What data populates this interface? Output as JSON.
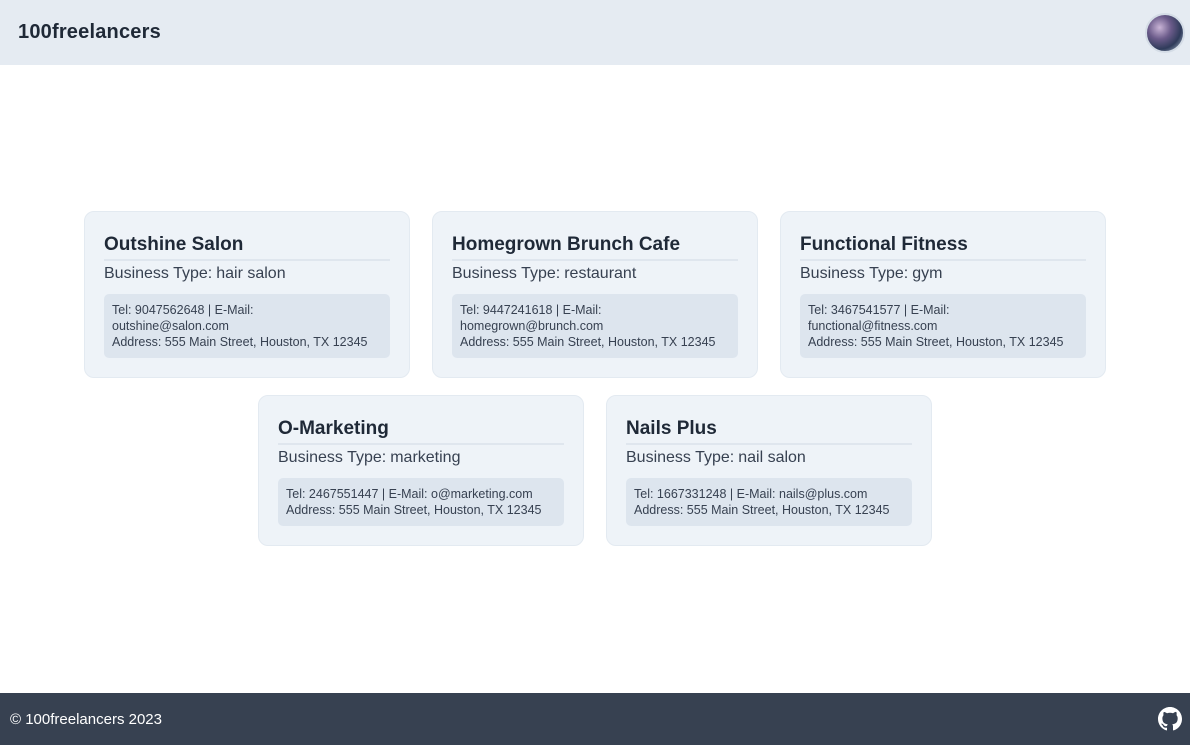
{
  "header": {
    "brand": "100freelancers"
  },
  "business_type_label": "Business Type:",
  "cards": [
    {
      "name": "Outshine Salon",
      "type": "hair salon",
      "contact_line1": "Tel: 9047562648 | E-Mail:",
      "contact_line2": "outshine@salon.com",
      "address": "Address: 555 Main Street, Houston, TX 12345"
    },
    {
      "name": "Homegrown Brunch Cafe",
      "type": "restaurant",
      "contact_line1": "Tel: 9447241618 | E-Mail:",
      "contact_line2": "homegrown@brunch.com",
      "address": "Address: 555 Main Street, Houston, TX 12345"
    },
    {
      "name": "Functional Fitness",
      "type": "gym",
      "contact_line1": "Tel: 3467541577 | E-Mail:",
      "contact_line2": "functional@fitness.com",
      "address": "Address: 555 Main Street, Houston, TX 12345"
    },
    {
      "name": "O-Marketing",
      "type": "marketing",
      "contact_line1": "Tel: 2467551447 | E-Mail: o@marketing.com",
      "address": "Address: 555 Main Street, Houston, TX 12345"
    },
    {
      "name": "Nails Plus",
      "type": "nail salon",
      "contact_line1": "Tel: 1667331248 | E-Mail: nails@plus.com",
      "address": "Address: 555 Main Street, Houston, TX 12345"
    }
  ],
  "footer": {
    "copyright": "© 100freelancers 2023",
    "icon": "github-icon"
  },
  "colors": {
    "header_bg": "#e5ebf2",
    "card_bg": "#eef3f8",
    "contact_bg": "#dde5ee",
    "footer_bg": "#374151"
  }
}
